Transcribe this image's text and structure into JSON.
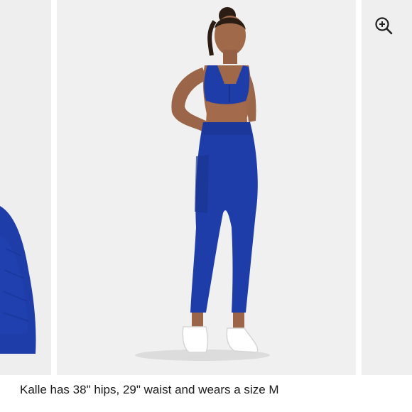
{
  "carousel": {
    "slides": [
      {
        "name": "previous-slide",
        "alt": "Leggings side detail close-up"
      },
      {
        "name": "current-slide",
        "alt": "Model wearing blue sports bra and leggings with white sneakers"
      },
      {
        "name": "next-slide",
        "alt": "Next product image"
      }
    ],
    "zoom_icon": "zoom-in-icon"
  },
  "caption": {
    "text": "Kalle has 38\" hips, 29\" waist and wears a size M"
  },
  "colors": {
    "garment_blue": "#1f3da8",
    "background": "#f0f0f0",
    "text": "#1a1a1a"
  }
}
